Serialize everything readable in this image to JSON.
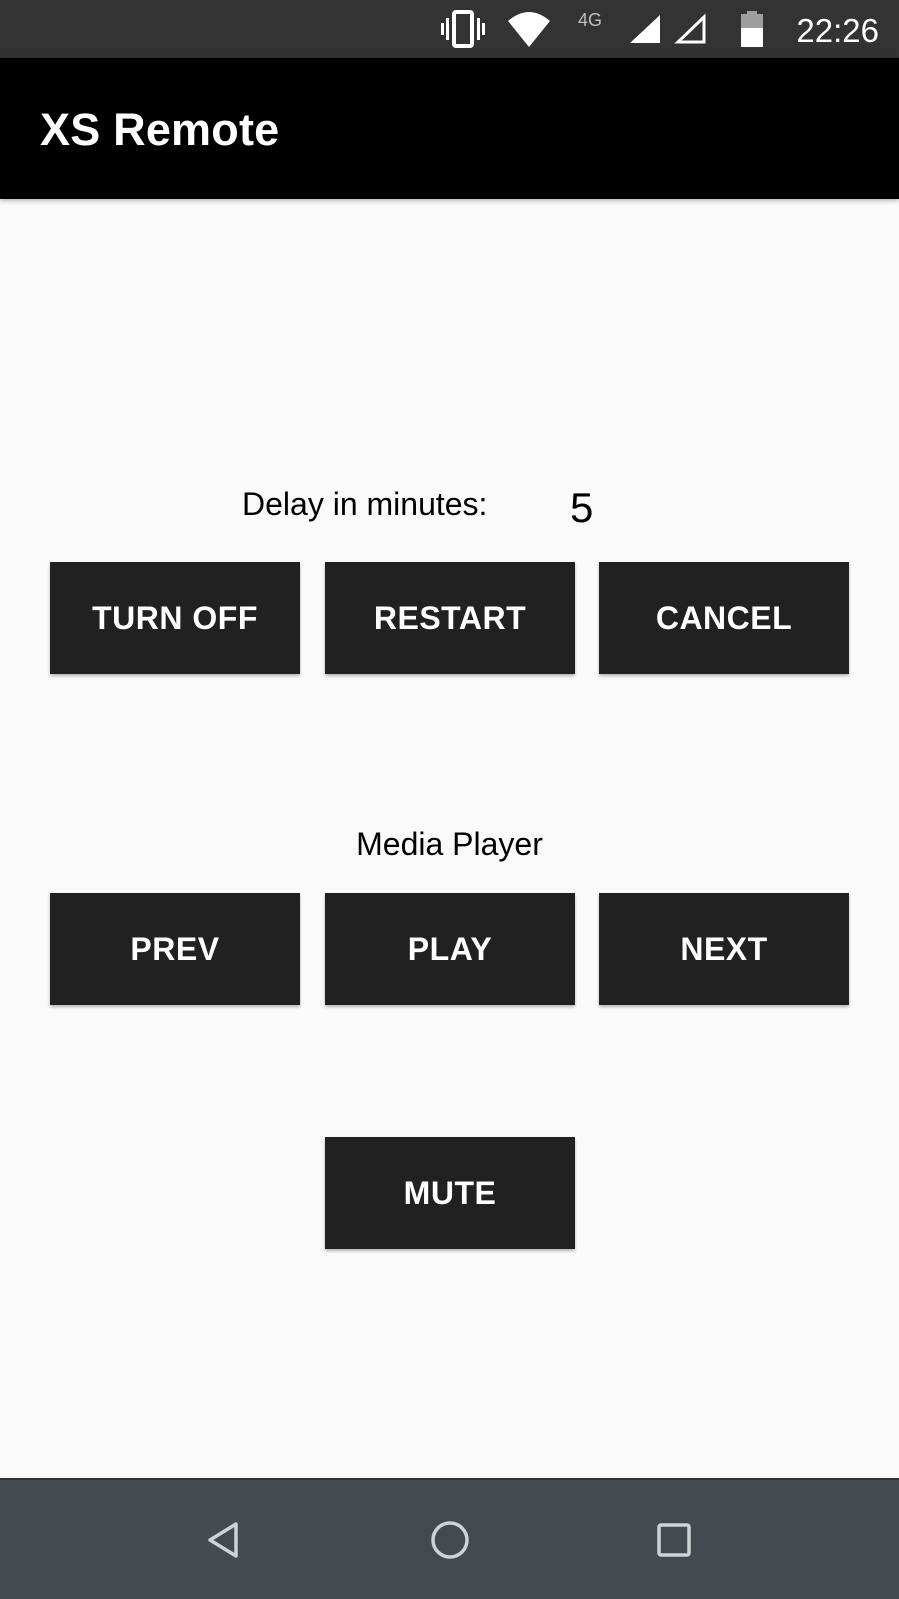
{
  "status_bar": {
    "network_label": "4G",
    "time": "22:26",
    "icons": [
      "vibrate-icon",
      "wifi-icon",
      "signal-full-icon",
      "signal-empty-icon",
      "battery-icon"
    ]
  },
  "app_bar": {
    "title": "XS Remote",
    "background": "#000000"
  },
  "delay": {
    "label": "Delay in minutes:",
    "value": "5"
  },
  "power_buttons": {
    "turn_off": "TURN OFF",
    "restart": "RESTART",
    "cancel": "CANCEL"
  },
  "media": {
    "label": "Media Player",
    "prev": "PREV",
    "play": "PLAY",
    "next": "NEXT",
    "mute": "MUTE"
  },
  "nav_bar": {
    "icons": [
      "back-icon",
      "home-icon",
      "recents-icon"
    ]
  },
  "colors": {
    "button_bg": "#212121",
    "button_text": "#ffffff",
    "content_bg": "#fafafa",
    "status_bar_bg": "#333333",
    "nav_bar_bg": "#434a50"
  }
}
